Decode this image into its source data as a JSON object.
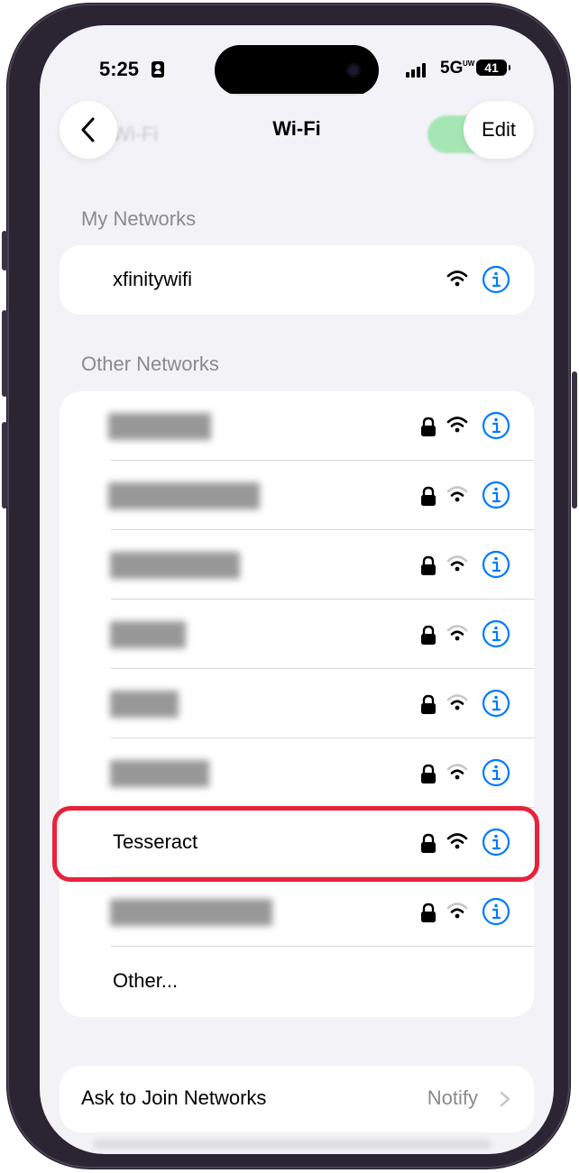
{
  "status_bar": {
    "time": "5:25",
    "network": "5G",
    "network_sub": "UW",
    "battery": "41"
  },
  "nav": {
    "title": "Wi-Fi",
    "edit_label": "Edit",
    "ghost_title": "Wi-Fi"
  },
  "my_networks": {
    "header": "My Networks",
    "items": [
      {
        "name": "xfinitywifi",
        "locked": false
      }
    ]
  },
  "other_networks": {
    "header": "Other Networks",
    "items": [
      {
        "name": "",
        "redacted": true,
        "locked": true,
        "signal": "strong"
      },
      {
        "name": "",
        "redacted": true,
        "locked": true,
        "signal": "medium"
      },
      {
        "name": "",
        "redacted": true,
        "locked": true,
        "signal": "medium"
      },
      {
        "name": "",
        "redacted": true,
        "locked": true,
        "signal": "medium"
      },
      {
        "name": "",
        "redacted": true,
        "locked": true,
        "signal": "medium"
      },
      {
        "name": "",
        "redacted": true,
        "locked": true,
        "signal": "medium"
      },
      {
        "name": "Tesseract",
        "redacted": false,
        "locked": true,
        "signal": "strong",
        "highlighted": true
      },
      {
        "name": "",
        "redacted": true,
        "locked": true,
        "signal": "medium"
      }
    ],
    "other_label": "Other..."
  },
  "ask_to_join": {
    "label": "Ask to Join Networks",
    "value": "Notify"
  },
  "colors": {
    "accent": "#007aff",
    "highlight": "#e8223a",
    "background": "#f2f2f7",
    "secondary_text": "#8a8a8e"
  },
  "icons": [
    "chevron-left-icon",
    "lock-icon",
    "wifi-icon",
    "info-icon",
    "chevron-right-icon",
    "person-badge-icon"
  ]
}
